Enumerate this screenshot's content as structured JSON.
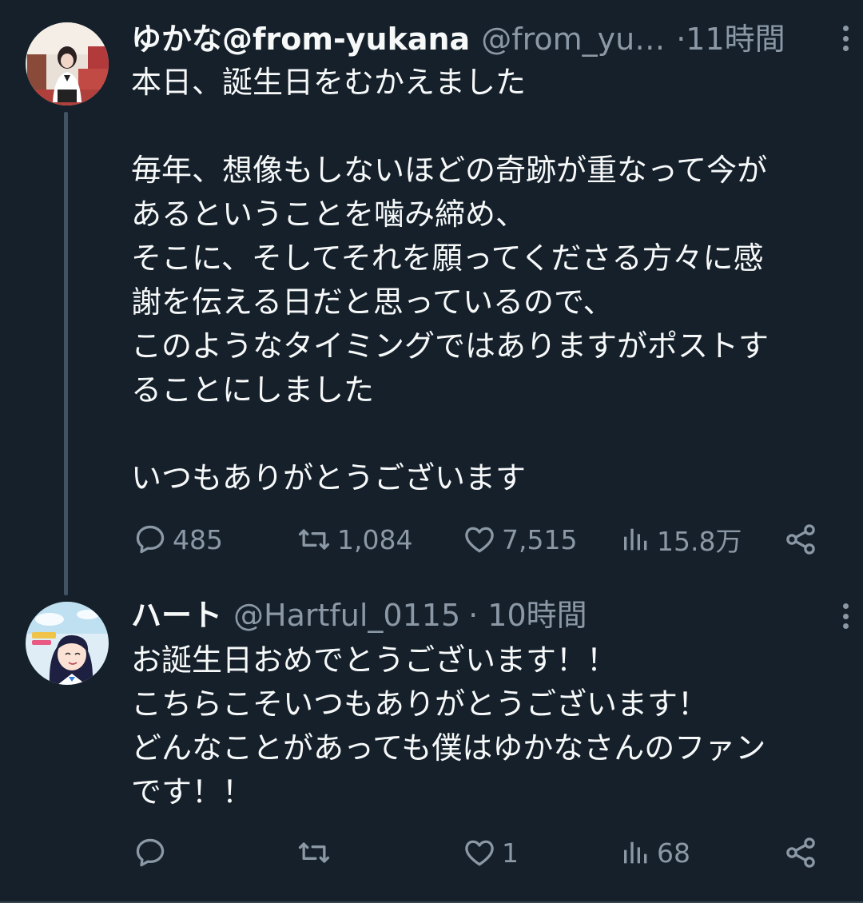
{
  "tweets": [
    {
      "display_name": "ゆかな@from-yukana",
      "handle": "@from_yu…",
      "time": "·11時間",
      "lines": [
        "本日、誕生日をむかえました",
        "",
        "毎年、想像もしないほどの奇跡が重なって今が",
        "あるということを噛み締め、",
        "そこに、そしてそれを願ってくださる方々に感",
        "謝を伝える日だと思っているので、",
        "このようなタイミングではありますがポストす",
        "ることにしました",
        "",
        "いつもありがとうございます"
      ],
      "stats": {
        "replies": "485",
        "retweets": "1,084",
        "likes": "7,515",
        "views": "15.8万"
      }
    },
    {
      "display_name": "ハート",
      "handle": "@Hartful_0115",
      "time": "· 10時間",
      "lines": [
        "お誕生日おめでとうございます！！",
        "こちらこそいつもありがとうございます！",
        "どんなことがあっても僕はゆかなさんのファン",
        "です！！"
      ],
      "stats": {
        "replies": "",
        "retweets": "",
        "likes": "1",
        "views": "68"
      }
    }
  ],
  "icons": {
    "reply": "speech-bubble-icon",
    "retweet": "retweet-arrows-icon",
    "like": "heart-icon",
    "views": "bar-chart-icon",
    "share": "share-nodes-icon",
    "more": "vertical-ellipsis-icon"
  },
  "colors": {
    "background": "#15202b",
    "primary_text": "#f7f9f9",
    "secondary_text": "#8b98a5",
    "thread_line": "#425364"
  }
}
